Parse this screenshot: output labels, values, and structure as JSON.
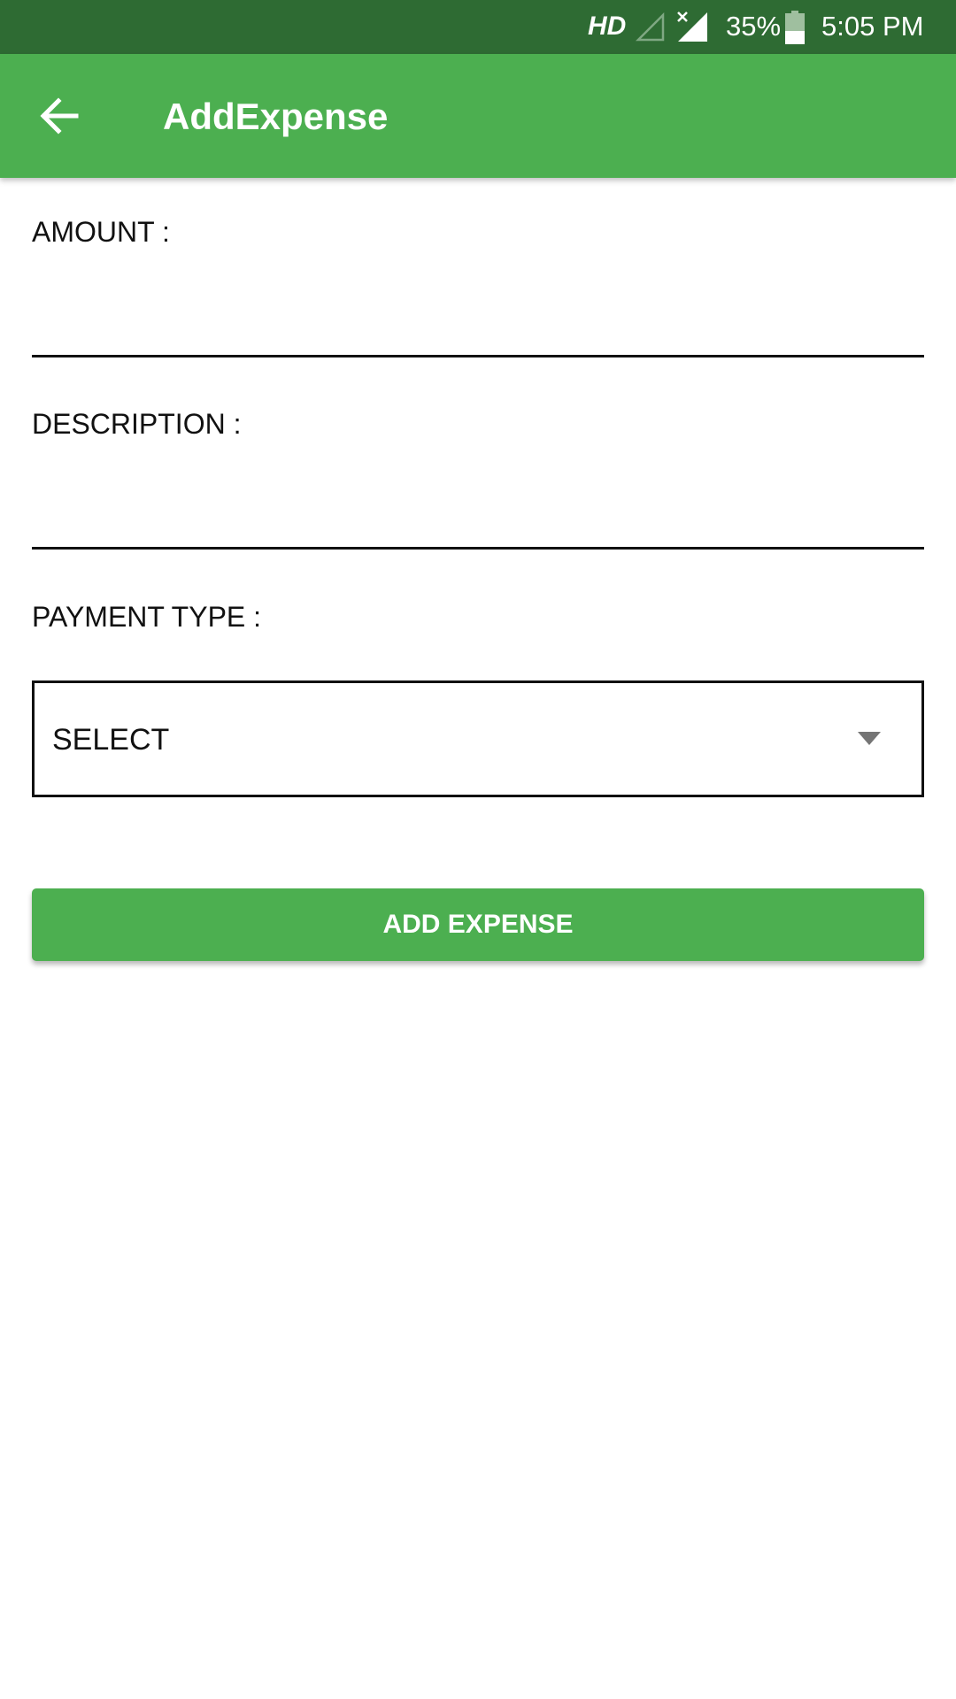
{
  "status_bar": {
    "network_label": "HD",
    "battery_percent": "35%",
    "time": "5:05 PM",
    "icons": [
      "signal-empty-icon",
      "signal-no-data-icon",
      "battery-icon"
    ]
  },
  "app_bar": {
    "title": "AddExpense",
    "back_icon": "arrow-back-icon",
    "color": "#4caf50"
  },
  "form": {
    "amount_label": "AMOUNT :",
    "amount_value": "",
    "description_label": "DESCRIPTION :",
    "description_value": "",
    "payment_type_label": "PAYMENT TYPE :",
    "payment_type_selected": "SELECT",
    "dropdown_icon": "dropdown-arrow-icon"
  },
  "actions": {
    "add_expense_label": "ADD EXPENSE"
  },
  "colors": {
    "status_bar": "#2e6b33",
    "primary": "#4caf50"
  }
}
